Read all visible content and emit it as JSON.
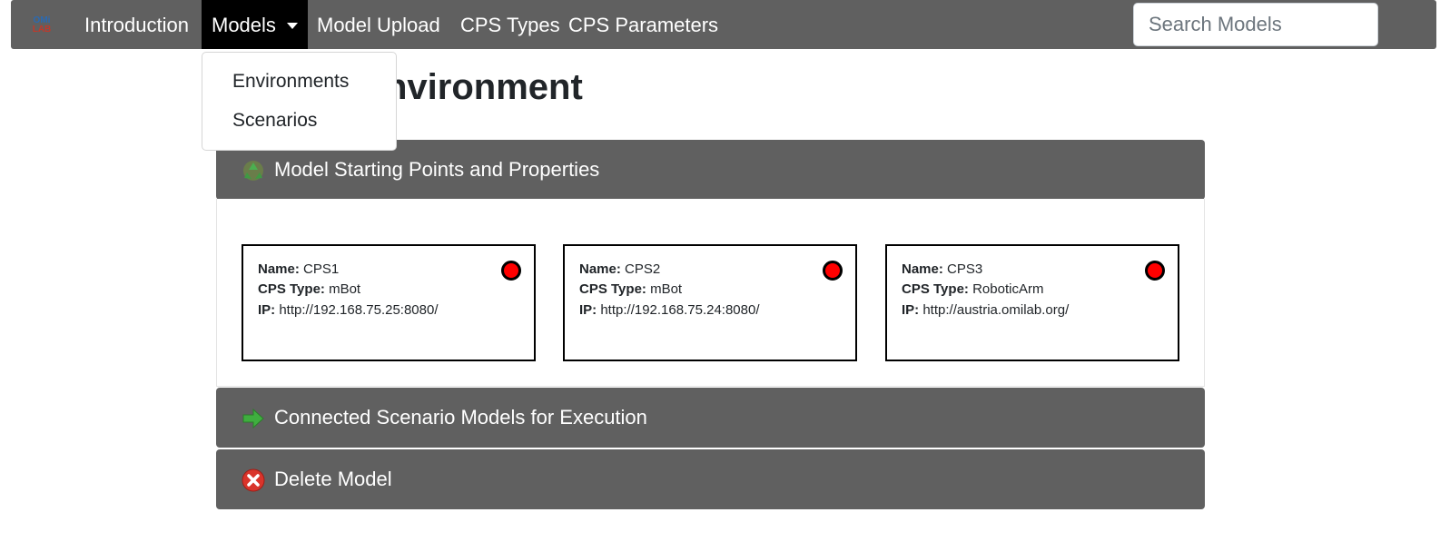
{
  "navbar": {
    "logo": {
      "line1": "OMi",
      "line2": "LAB"
    },
    "items": [
      {
        "label": "Introduction"
      },
      {
        "label": "Models"
      },
      {
        "label": "Model Upload"
      },
      {
        "label": "CPS Types"
      },
      {
        "label": "CPS Parameters"
      }
    ],
    "search": {
      "placeholder": "Search Models",
      "value": ""
    }
  },
  "dropdown": {
    "items": [
      {
        "label": "Environments"
      },
      {
        "label": "Scenarios"
      }
    ]
  },
  "page": {
    "title_visible": "nvironment"
  },
  "panels": [
    {
      "label": "Model Starting Points and Properties",
      "icon": "recycle-icon"
    },
    {
      "label": "Connected Scenario Models for Execution",
      "icon": "arrow-right-icon"
    },
    {
      "label": "Delete Model",
      "icon": "delete-icon"
    }
  ],
  "labels": {
    "name": "Name:",
    "cps_type": "CPS Type:",
    "ip": "IP:"
  },
  "cards": [
    {
      "name": "CPS1",
      "cps_type": "mBot",
      "ip": "http://192.168.75.25:8080/",
      "status_color": "#ff0000"
    },
    {
      "name": "CPS2",
      "cps_type": "mBot",
      "ip": "http://192.168.75.24:8080/",
      "status_color": "#ff0000"
    },
    {
      "name": "CPS3",
      "cps_type": "RoboticArm",
      "ip": "http://austria.omilab.org/",
      "status_color": "#ff0000"
    }
  ],
  "colors": {
    "navbar_bg": "#606060",
    "active_nav_bg": "#000000",
    "panel_header_bg": "#606060",
    "status_offline": "#ff0000"
  }
}
